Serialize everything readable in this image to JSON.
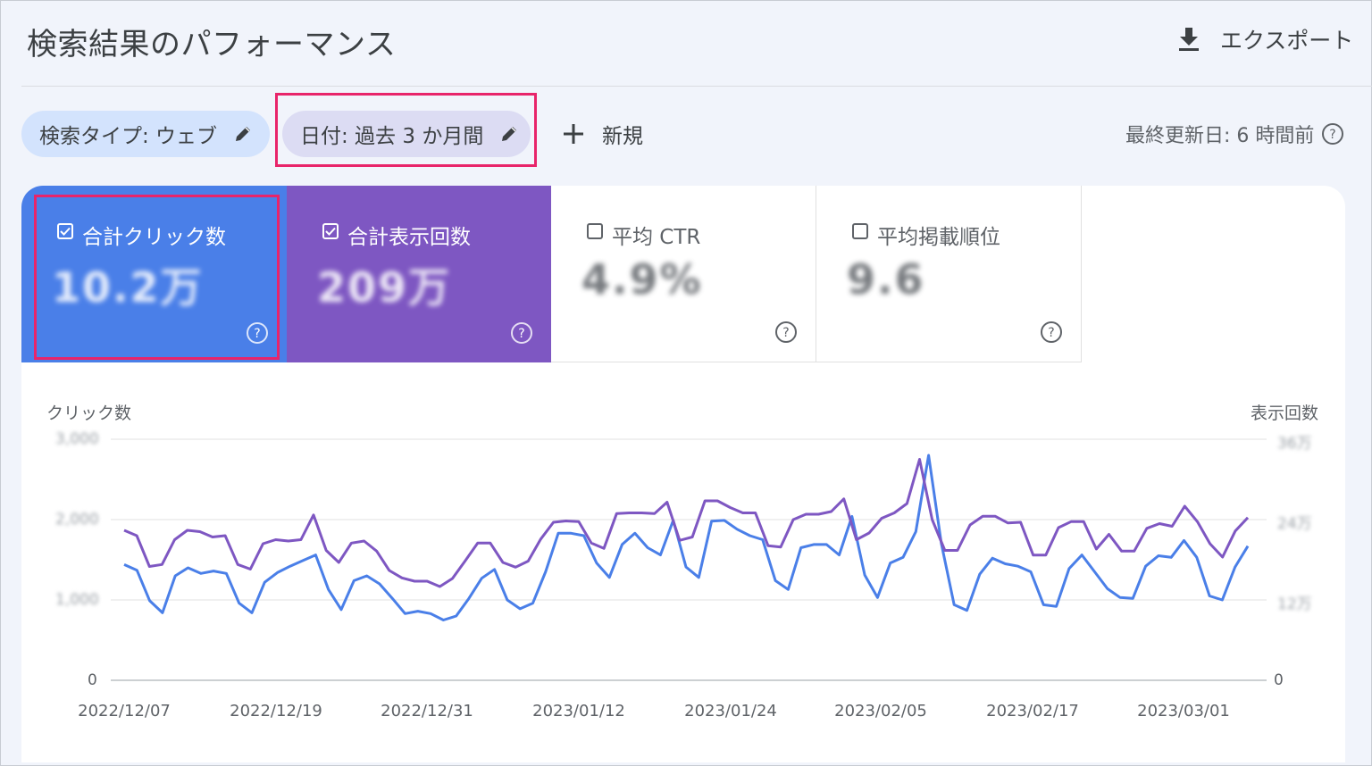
{
  "header": {
    "title": "検索結果のパフォーマンス",
    "export_label": "エクスポート"
  },
  "filters": {
    "search_type": "検索タイプ: ウェブ",
    "date": "日付: 過去 3 か月間",
    "new_label": "新規",
    "last_updated": "最終更新日: 6 時間前"
  },
  "metrics": [
    {
      "label": "合計クリック数",
      "checked": true,
      "value": "10.2万"
    },
    {
      "label": "合計表示回数",
      "checked": true,
      "value": "209万"
    },
    {
      "label": "平均 CTR",
      "checked": false,
      "value": "4.9%"
    },
    {
      "label": "平均掲載順位",
      "checked": false,
      "value": "9.6"
    }
  ],
  "colors": {
    "clicks": "#4a7fe8",
    "impressions": "#7e57c2",
    "highlight": "#e8246a",
    "chip": "#d3e3fd"
  },
  "chart_data": {
    "type": "line",
    "left_axis_label": "クリック数",
    "right_axis_label": "表示回数",
    "left_ticks": [
      "3,000",
      "2,000",
      "1,000",
      "0"
    ],
    "right_ticks": [
      "36万",
      "24万",
      "12万",
      "0"
    ],
    "left_ylim": [
      0,
      3000
    ],
    "right_ylim": [
      0,
      360000
    ],
    "x_labels": [
      "2022/12/07",
      "2022/12/19",
      "2022/12/31",
      "2023/01/12",
      "2023/01/24",
      "2023/02/05",
      "2023/02/17",
      "2023/03/01"
    ],
    "series": [
      {
        "name": "クリック数",
        "axis": "left",
        "color": "#4a7fe8",
        "values": [
          1440,
          1370,
          990,
          840,
          1300,
          1400,
          1330,
          1360,
          1330,
          960,
          840,
          1220,
          1340,
          1420,
          1490,
          1560,
          1130,
          880,
          1240,
          1300,
          1200,
          1020,
          830,
          860,
          830,
          750,
          800,
          1020,
          1270,
          1380,
          1000,
          890,
          960,
          1350,
          1830,
          1830,
          1800,
          1460,
          1280,
          1690,
          1830,
          1650,
          1560,
          1990,
          1410,
          1280,
          1980,
          1990,
          1880,
          1800,
          1750,
          1240,
          1130,
          1650,
          1690,
          1690,
          1560,
          2040,
          1310,
          1030,
          1460,
          1530,
          1850,
          2800,
          1700,
          940,
          870,
          1320,
          1520,
          1450,
          1420,
          1350,
          940,
          920,
          1390,
          1560,
          1350,
          1140,
          1030,
          1020,
          1420,
          1550,
          1530,
          1740,
          1530,
          1050,
          1000,
          1410,
          1670
        ]
      },
      {
        "name": "表示回数",
        "axis": "right",
        "color": "#7e57c2",
        "values": [
          224000,
          216000,
          170000,
          173000,
          210000,
          224000,
          222000,
          214000,
          216000,
          173000,
          166000,
          204000,
          210000,
          208000,
          210000,
          247000,
          194000,
          176000,
          205000,
          208000,
          193000,
          164000,
          153000,
          148000,
          148000,
          140000,
          152000,
          178000,
          205000,
          205000,
          176000,
          169000,
          178000,
          211000,
          236000,
          238000,
          237000,
          205000,
          197000,
          249000,
          250000,
          250000,
          249000,
          266000,
          209000,
          214000,
          268000,
          268000,
          258000,
          250000,
          250000,
          201000,
          199000,
          240000,
          248000,
          248000,
          252000,
          271000,
          210000,
          220000,
          242000,
          250000,
          264000,
          330000,
          240000,
          194000,
          194000,
          232000,
          245000,
          245000,
          235000,
          236000,
          187000,
          187000,
          228000,
          237000,
          237000,
          196000,
          218000,
          193000,
          193000,
          227000,
          234000,
          230000,
          260000,
          237000,
          204000,
          184000,
          223000,
          243000
        ]
      }
    ]
  }
}
